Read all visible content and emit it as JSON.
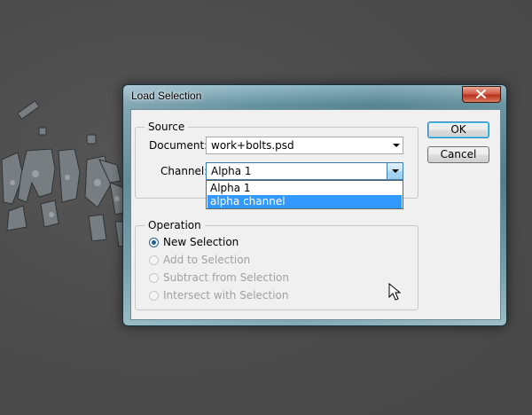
{
  "window": {
    "title": "Load Selection"
  },
  "source": {
    "group_label": "Source",
    "document_label": "Document:",
    "document_value": "work+bolts.psd",
    "channel_label": "Channel:",
    "channel_value": "Alpha 1",
    "channel_options": [
      "Alpha 1",
      "alpha channel"
    ],
    "channel_highlighted": "alpha channel"
  },
  "operation": {
    "group_label": "Operation",
    "options": [
      {
        "label": "New Selection",
        "checked": true,
        "enabled": true
      },
      {
        "label": "Add to Selection",
        "checked": false,
        "enabled": false
      },
      {
        "label": "Subtract from Selection",
        "checked": false,
        "enabled": false
      },
      {
        "label": "Intersect with Selection",
        "checked": false,
        "enabled": false
      }
    ]
  },
  "buttons": {
    "ok": "OK",
    "cancel": "Cancel"
  },
  "colors": {
    "highlight": "#3399ff",
    "window_frame": "#3f6e7e",
    "close_button": "#c8442c"
  }
}
